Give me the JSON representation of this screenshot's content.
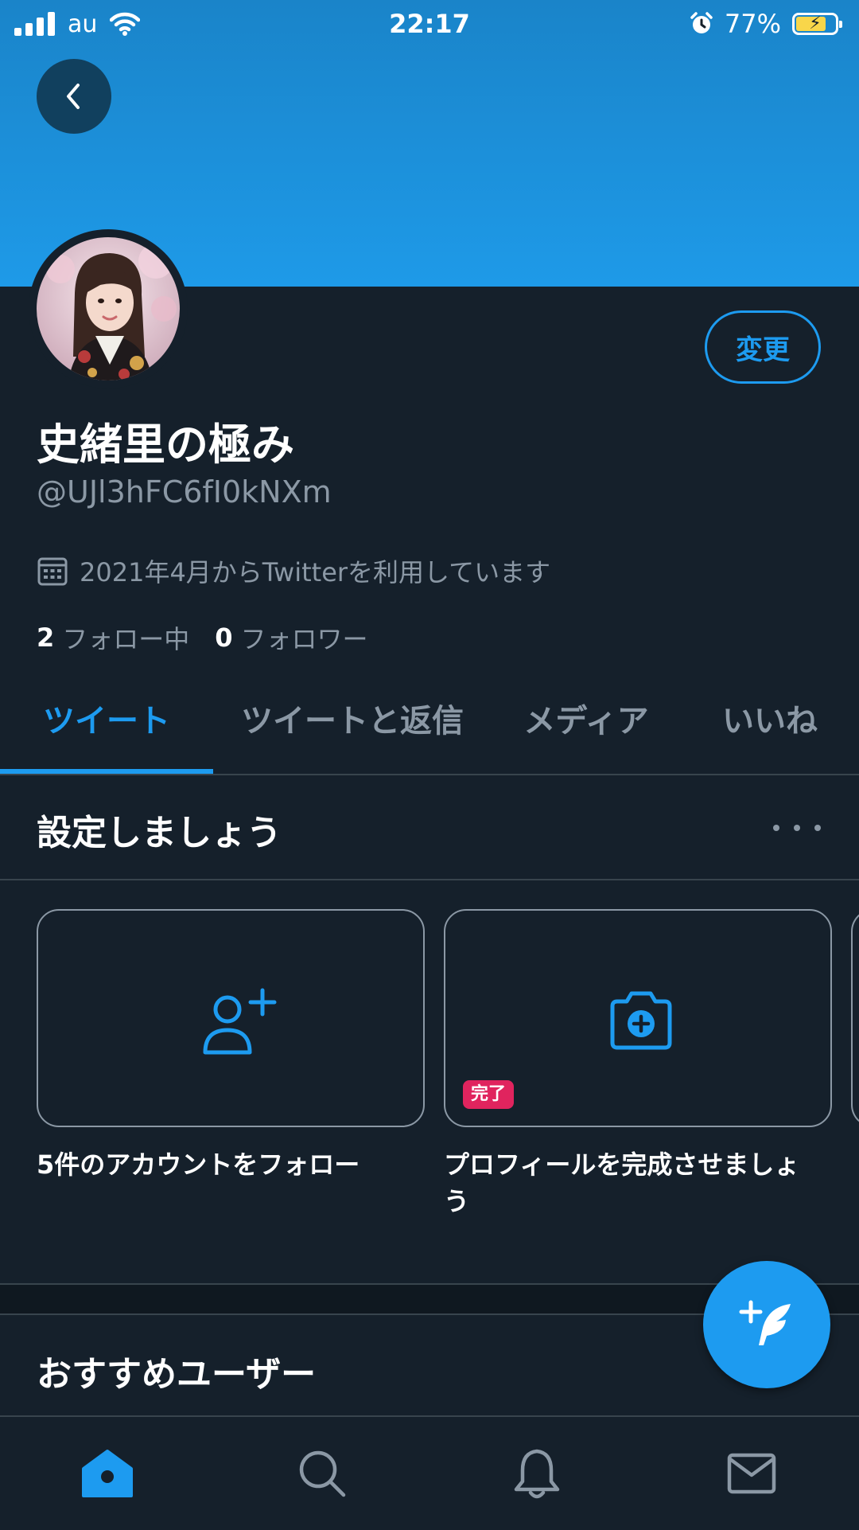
{
  "status_bar": {
    "carrier": "au",
    "time": "22:17",
    "battery_percent": "77%",
    "battery_level": 0.77,
    "icons": [
      "signal-icon",
      "wifi-icon",
      "alarm-icon",
      "battery-charging-icon"
    ]
  },
  "header": {
    "back_icon": "chevron-left-icon"
  },
  "profile": {
    "display_name": "史緒里の極み",
    "handle": "@UJl3hFC6fI0kNXm",
    "joined_text": "2021年4月からTwitterを利用しています",
    "following_count": "2",
    "following_label": "フォロー中",
    "followers_count": "0",
    "followers_label": "フォロワー",
    "edit_button_label": "変更"
  },
  "tabs": [
    {
      "label": "ツイート",
      "active": true
    },
    {
      "label": "ツイートと返信",
      "active": false
    },
    {
      "label": "メディア",
      "active": false
    },
    {
      "label": "いいね",
      "active": false
    }
  ],
  "setup": {
    "title": "設定しましょう",
    "cards": [
      {
        "label": "5件のアカウントをフォロー",
        "icon": "add-user-icon"
      },
      {
        "label": "プロフィールを完成させましょう",
        "icon": "camera-plus-icon",
        "badge": "完了"
      }
    ]
  },
  "recommended": {
    "title": "おすすめユーザー"
  },
  "bottom_nav": [
    "home-icon",
    "search-icon",
    "bell-icon",
    "mail-icon"
  ],
  "colors": {
    "background": "#15202b",
    "accent": "#1d9bf0",
    "secondary_text": "#8b98a5",
    "badge": "#e0245e"
  }
}
